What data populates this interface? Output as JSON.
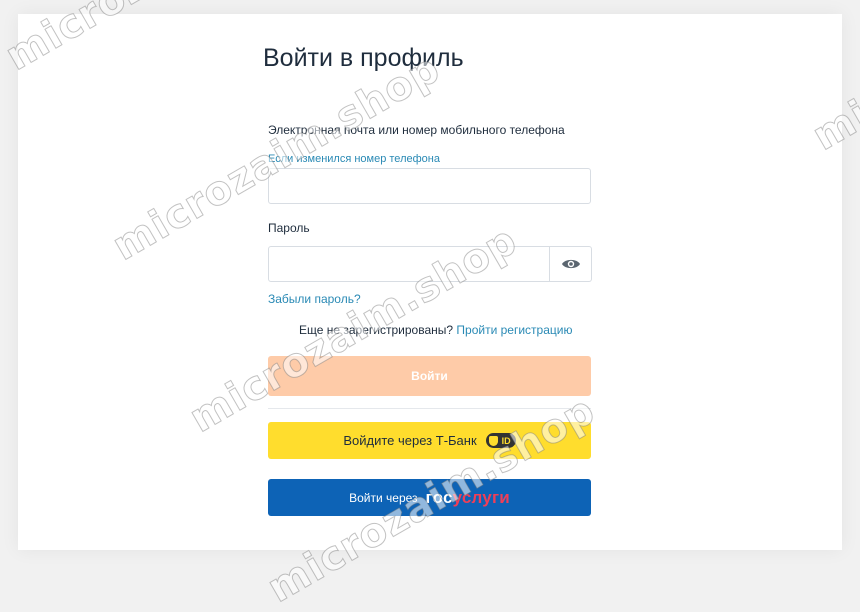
{
  "page": {
    "title": "Войти в профиль"
  },
  "login_form": {
    "login_label": "Электронная почта или номер мобильного телефона",
    "phone_changed_link": "Если изменился номер телефона",
    "login_value": "",
    "password_label": "Пароль",
    "password_value": "",
    "show_password_icon": "eye-icon",
    "forgot_password_link": "Забыли пароль?",
    "not_registered_text": "Еще не зарегистрированы?",
    "register_link": "Пройти регистрацию",
    "login_button": "Войти"
  },
  "alt_login": {
    "tbank_button": "Войдите через Т-Банк",
    "tbank_badge": "ID",
    "gosuslugi_prefix": "Войти через",
    "gosuslugi_logo_part1": "гос",
    "gosuslugi_logo_part2": "услуги"
  },
  "watermark": {
    "text": "microzaim.shop"
  },
  "colors": {
    "accent_link": "#2a8ab5",
    "login_button_disabled": "#fecba8",
    "tbank_yellow": "#ffdd2d",
    "gosuslugi_blue": "#0d63b6",
    "gosuslugi_red": "#ee3f58"
  }
}
